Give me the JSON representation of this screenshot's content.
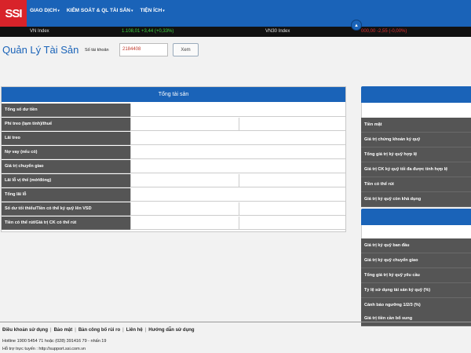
{
  "logo": {
    "text": "SSI"
  },
  "nav": [
    {
      "label": "GIAO DỊCH"
    },
    {
      "label": "KIỂM SOÁT & QL TÀI SẢN"
    },
    {
      "label": "TIỆN ÍCH"
    }
  ],
  "ticker": {
    "vn_label": "VN Index",
    "vn_value": "1.108,01 +3,44 (+0,33%)",
    "vn30_label": "VN30 Index",
    "vn30_value": "000,00 -2,55 (-0,00%)"
  },
  "page": {
    "title": "Quản Lý Tài Sản",
    "account_label": "Số tài khoản",
    "account_value": "2184408",
    "view_button": "Xem"
  },
  "main_table": {
    "header": "Tổng tài sản",
    "rows": [
      {
        "label": "Tổng số dư tiền"
      },
      {
        "label": "Phí treo (tạm tính)/thuế"
      },
      {
        "label": "Lãi treo"
      },
      {
        "label": "Nợ vay (nếu có)"
      },
      {
        "label": "Giá trị chuyển giao"
      },
      {
        "label": "Lãi lỗ vị thế (mở/đóng)"
      },
      {
        "label": "Tổng lãi lỗ"
      },
      {
        "label": "Số dư tối thiểu/Tiền có thể ký quỹ lên VSD"
      },
      {
        "label": "Tiền có thể rút/Giá trị CK có thể rút"
      }
    ]
  },
  "side_panel_1": {
    "rows": [
      {
        "label": "Tiền mặt"
      },
      {
        "label": "Giá trị chứng khoán ký quỹ"
      },
      {
        "label": "Tổng giá trị ký quỹ hợp lệ"
      },
      {
        "label": "Giá trị CK ký quỹ tối đa được tính hợp lệ"
      },
      {
        "label": "Tiền có thể rút"
      },
      {
        "label": "Giá trị ký quỹ còn khả dụng"
      }
    ]
  },
  "side_panel_2": {
    "rows": [
      {
        "label": "Giá trị ký quỹ ban đầu"
      },
      {
        "label": "Giá trị ký quỹ chuyển giao"
      },
      {
        "label": "Tổng giá trị ký quỹ yêu cầu"
      },
      {
        "label": "Tỷ lệ sử dụng tài sản ký quỹ (%)"
      },
      {
        "label": "Cảnh báo ngưỡng 1/2/3 (%)"
      },
      {
        "label": "Giá trị tiền cần bổ sung"
      }
    ]
  },
  "footer": {
    "links": [
      "Điều khoản sử dụng",
      "Bảo mật",
      "Bản công bố rủi ro",
      "Liên hệ",
      "Hướng dẫn sử dụng"
    ],
    "hotline": "Hotline 1900 5454 71 hoặc (028) 391416 79 - nhấn 19",
    "support": "Hỗ trợ trực tuyến : http://support.ssi.com.vn"
  },
  "colors": {
    "brand_blue": "#1a63b8",
    "logo_red": "#d8232a",
    "up_green": "#3fd23f",
    "down_red": "#e03030"
  }
}
